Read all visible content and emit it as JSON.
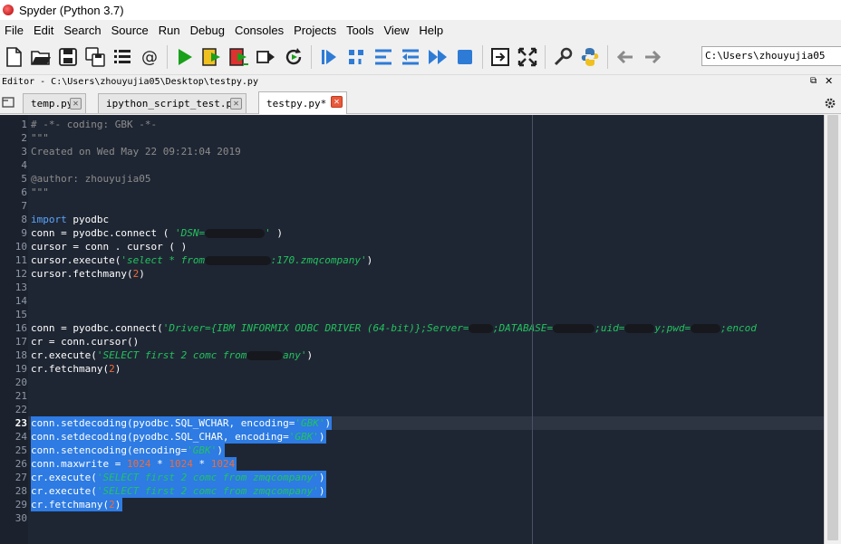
{
  "window": {
    "title": "Spyder (Python 3.7)"
  },
  "menu": [
    "File",
    "Edit",
    "Search",
    "Source",
    "Run",
    "Debug",
    "Consoles",
    "Projects",
    "Tools",
    "View",
    "Help"
  ],
  "toolbar": {
    "working_dir": "C:\\Users\\zhouyujia05",
    "icons": [
      "new-file-icon",
      "open-file-icon",
      "save-icon",
      "save-all-icon",
      "outline-icon",
      "at-icon",
      "run-icon",
      "run-cell-icon",
      "run-cell-advance-icon",
      "run-selection-icon",
      "rerun-icon",
      "debug-icon",
      "step-icon",
      "step-into-icon",
      "step-return-icon",
      "continue-icon",
      "stop-icon",
      "maximize-pane-icon",
      "fullscreen-icon",
      "preferences-icon",
      "pythonpath-icon",
      "back-icon",
      "forward-icon"
    ]
  },
  "editor": {
    "title": "Editor - C:\\Users\\zhouyujia05\\Desktop\\testpy.py",
    "tabs": [
      {
        "label": "temp.py"
      },
      {
        "label": "ipython_script_test.py"
      },
      {
        "label": "testpy.py*"
      }
    ],
    "current_line": 23,
    "selected_lines": [
      23,
      24,
      25,
      26,
      27,
      28,
      29
    ],
    "code_lines": [
      "# -*- coding: GBK -*-",
      "\"\"\"",
      "Created on Wed May 22 09:21:04 2019",
      "",
      "@author: zhouyujia05",
      "\"\"\"",
      "",
      "import pyodbc",
      "conn = pyodbc.connect ( 'DSN=          ' )",
      "cursor = conn . cursor ( )",
      "cursor.execute('select * from           :170.zmqcompany')",
      "cursor.fetchmany(2)",
      "",
      "",
      "",
      "conn = pyodbc.connect('Driver={IBM INFORMIX ODBC DRIVER (64-bit)};Server=    ;DATABASE=       ;uid=     y;pwd=     ;encod",
      "cr = conn.cursor()",
      "cr.execute('SELECT first 2 comc from      any')",
      "cr.fetchmany(2)",
      "",
      "",
      "",
      "conn.setdecoding(pyodbc.SQL_WCHAR, encoding='GBK')",
      "conn.setdecoding(pyodbc.SQL_CHAR, encoding='GBK')",
      "conn.setencoding(encoding='GBK')",
      "conn.maxwrite = 1024 * 1024 * 1024",
      "cr.execute('SELECT first 2 comc from zmqcompany')",
      "cr.execute('SELECT first 2 comc from zmqcompany')",
      "cr.fetchmany(2)",
      ""
    ]
  }
}
